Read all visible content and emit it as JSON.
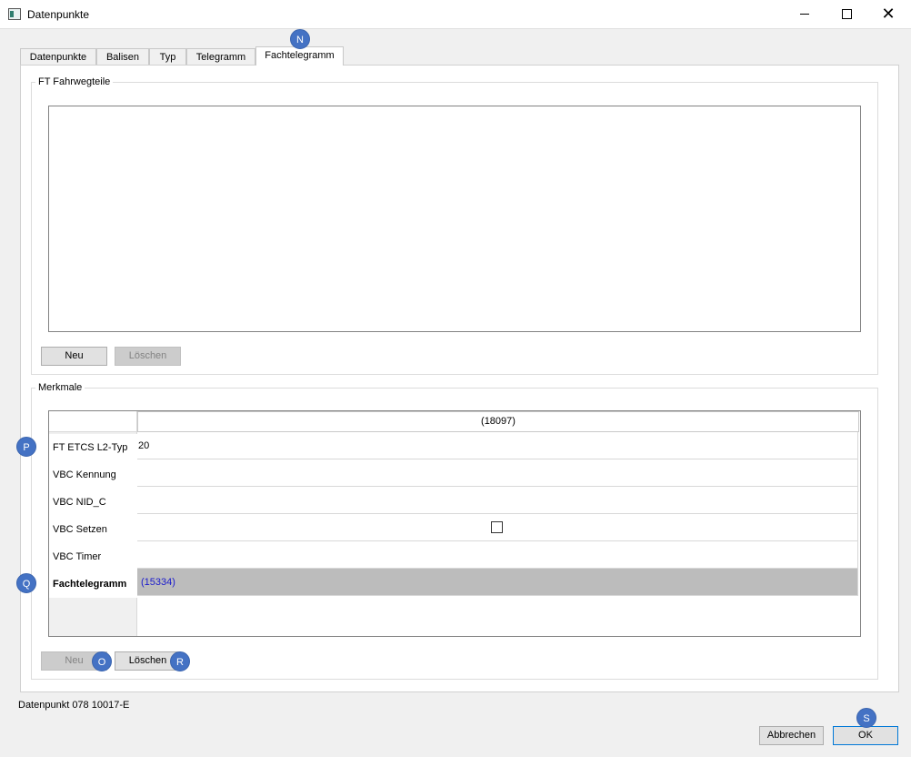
{
  "window": {
    "title": "Datenpunkte",
    "minimize_glyph": "",
    "maximize_glyph": "",
    "close_glyph": "✕"
  },
  "tabs": [
    {
      "label": "Datenpunkte"
    },
    {
      "label": "Balisen"
    },
    {
      "label": "Typ"
    },
    {
      "label": "Telegramm"
    },
    {
      "label": "Fachtelegramm",
      "active": true
    }
  ],
  "ft_group": {
    "title": "FT Fahrwegteile",
    "new_label": "Neu",
    "delete_label": "Löschen"
  },
  "merkmale": {
    "title": "Merkmale",
    "column_header": "(18097)",
    "rows": [
      {
        "label": "FT ETCS L2-Typ",
        "value": "20"
      },
      {
        "label": "VBC Kennung",
        "value": ""
      },
      {
        "label": "VBC NID_C",
        "value": ""
      },
      {
        "label": "VBC Setzen",
        "value": "",
        "checkbox": true
      },
      {
        "label": "VBC Timer",
        "value": ""
      },
      {
        "label": "Fachtelegramm",
        "value": "(15334)",
        "bold": true,
        "selected": true
      }
    ],
    "new_label": "Neu",
    "delete_label": "Löschen"
  },
  "status": {
    "datenpunkt": "Datenpunkt 078 10017-E"
  },
  "footer": {
    "cancel_label": "Abbrechen",
    "ok_label": "OK"
  },
  "markers": {
    "n": "N",
    "o": "O",
    "p": "P",
    "q": "Q",
    "r": "R",
    "s": "S"
  },
  "colors": {
    "marker": "#4472c4",
    "selected_cell": "#bcbcbc",
    "selected_text": "#1a1acc",
    "ok_border": "#0078d7"
  }
}
